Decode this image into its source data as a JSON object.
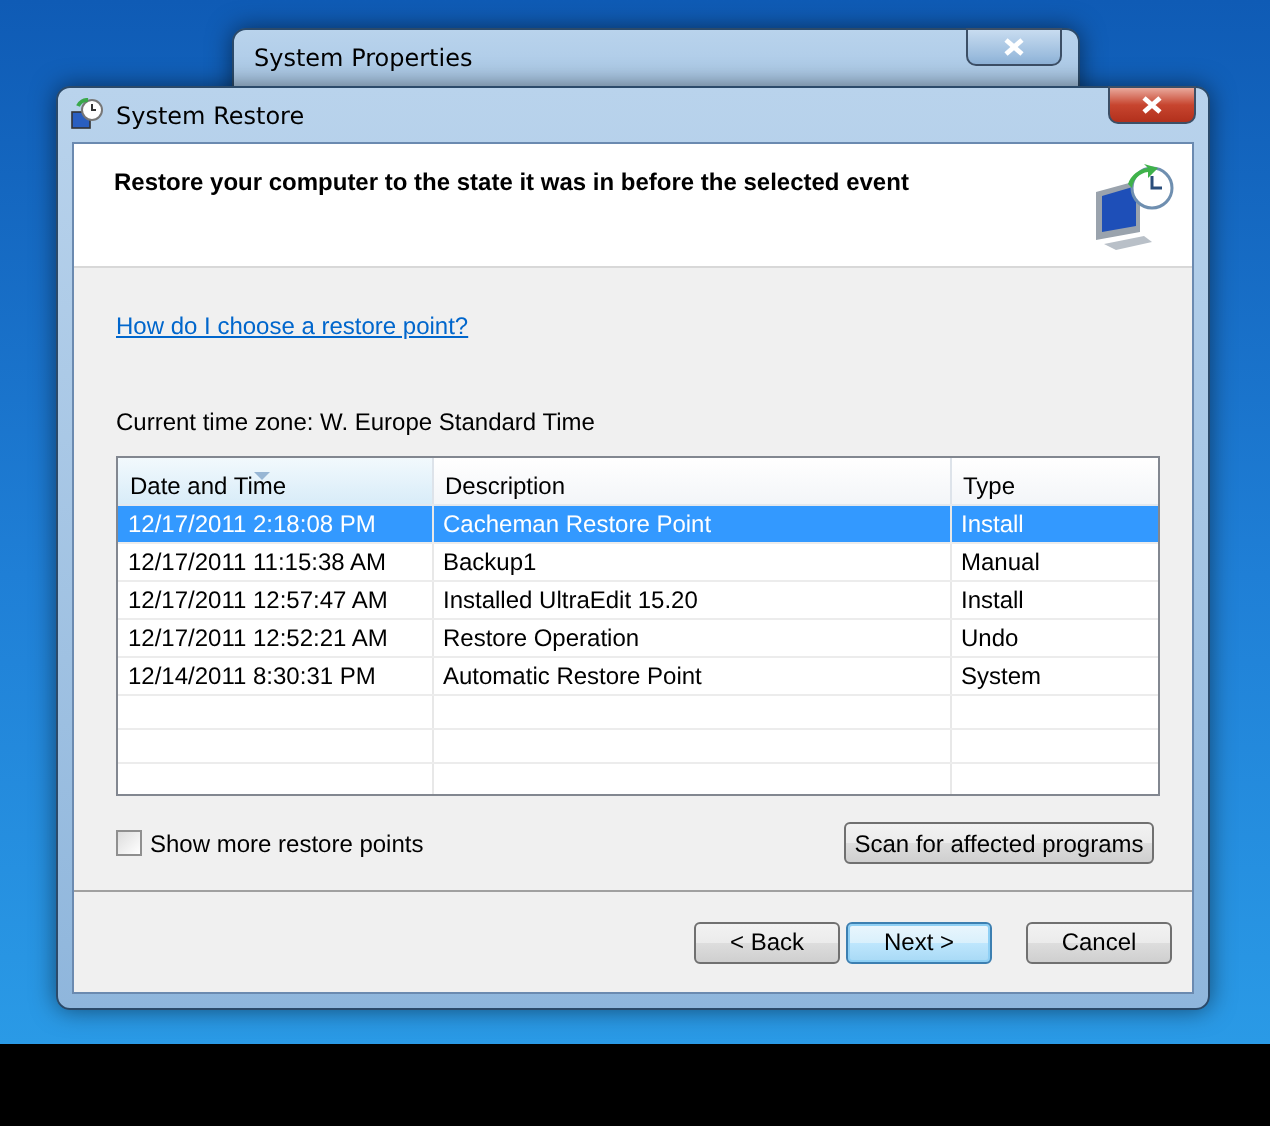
{
  "background_window": {
    "title": "System Properties"
  },
  "window": {
    "title": "System Restore"
  },
  "header": {
    "heading": "Restore your computer to the state it was in before the selected event"
  },
  "help_link": "How do I choose a restore point?",
  "time_zone": "Current time zone: W. Europe Standard Time",
  "table": {
    "columns": [
      {
        "label": "Date and Time",
        "sorted": true
      },
      {
        "label": "Description",
        "sorted": false
      },
      {
        "label": "Type",
        "sorted": false
      }
    ],
    "rows": [
      {
        "cells": [
          "12/17/2011 2:18:08 PM",
          "Cacheman Restore Point",
          "Install"
        ],
        "selected": true
      },
      {
        "cells": [
          "12/17/2011 11:15:38 AM",
          "Backup1",
          "Manual"
        ],
        "selected": false
      },
      {
        "cells": [
          "12/17/2011 12:57:47 AM",
          "Installed UltraEdit 15.20",
          "Install"
        ],
        "selected": false
      },
      {
        "cells": [
          "12/17/2011 12:52:21 AM",
          "Restore Operation",
          "Undo"
        ],
        "selected": false
      },
      {
        "cells": [
          "12/14/2011 8:30:31 PM",
          "Automatic Restore Point",
          "System"
        ],
        "selected": false
      }
    ]
  },
  "show_more": {
    "label": "Show more restore points",
    "checked": false
  },
  "scan_button": "Scan for affected programs",
  "buttons": [
    {
      "label": "< Back",
      "default": false
    },
    {
      "label": "Next >",
      "default": true
    },
    {
      "label": "Cancel",
      "default": false
    }
  ]
}
